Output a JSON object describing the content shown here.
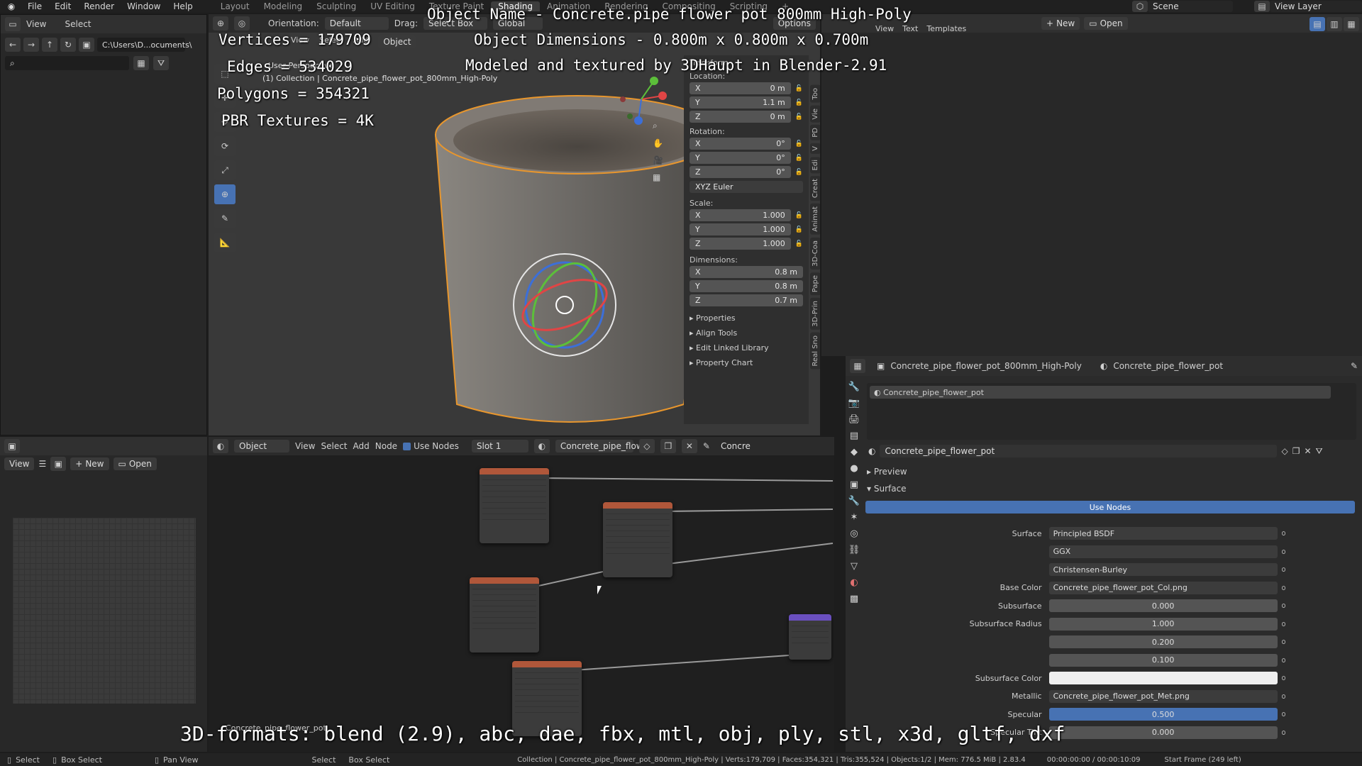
{
  "menu": [
    "File",
    "Edit",
    "Render",
    "Window",
    "Help"
  ],
  "workspaces": [
    "Layout",
    "Modeling",
    "Sculpting",
    "UV Editing",
    "Texture Paint",
    "Shading",
    "Animation",
    "Rendering",
    "Compositing",
    "Scripting"
  ],
  "active_workspace": "Shading",
  "scene": "Scene",
  "view_layer": "View Layer",
  "file_browser": {
    "view": "View",
    "select": "Select",
    "path": "C:\\Users\\D...ocuments\\"
  },
  "viewport": {
    "orientation_label": "Orientation:",
    "orientation_value": "Default",
    "drag_label": "Drag:",
    "drag_value": "Select Box",
    "transform_value": "Global",
    "options": "Options",
    "menu": [
      "View",
      "Select",
      "Add",
      "Object"
    ],
    "view_name": "User Perspective",
    "collection_line": "(1) Collection | Concrete_pipe_flower_pot_800mm_High-Poly"
  },
  "overlay": {
    "vertices": "Vertices = 179709",
    "edges": "Edges = 534029",
    "polygons": "Polygons = 354321",
    "textures": "PBR Textures = 4K",
    "object_name": "Object Name - Concrete.pipe flower pot 800mm High-Poly",
    "object_dims": "Object Dimensions - 0.800m x 0.800m x 0.700m",
    "credit": "Modeled and textured by 3DHaupt in Blender-2.91",
    "formats": "3D-formats: blend (2.9), abc, dae, fbx, mtl, obj, ply, stl, x3d, gltf, dxf"
  },
  "npanel": {
    "transform": "Transform",
    "location_label": "Location:",
    "location": [
      {
        "axis": "X",
        "value": "0 m"
      },
      {
        "axis": "Y",
        "value": "1.1 m"
      },
      {
        "axis": "Z",
        "value": "0 m"
      }
    ],
    "rotation_label": "Rotation:",
    "rotation": [
      {
        "axis": "X",
        "value": "0°"
      },
      {
        "axis": "Y",
        "value": "0°"
      },
      {
        "axis": "Z",
        "value": "0°"
      }
    ],
    "rotation_mode": "XYZ Euler",
    "scale_label": "Scale:",
    "scale": [
      {
        "axis": "X",
        "value": "1.000"
      },
      {
        "axis": "Y",
        "value": "1.000"
      },
      {
        "axis": "Z",
        "value": "1.000"
      }
    ],
    "dimensions_label": "Dimensions:",
    "dimensions": [
      {
        "axis": "X",
        "value": "0.8 m"
      },
      {
        "axis": "Y",
        "value": "0.8 m"
      },
      {
        "axis": "Z",
        "value": "0.7 m"
      }
    ],
    "sections": [
      "Properties",
      "Align Tools",
      "Edit Linked Library",
      "Property Chart"
    ],
    "tabs": [
      "Too",
      "Vie",
      "PD",
      "V",
      "Edi",
      "Creat",
      "Animat",
      "3D-Coa",
      "Pape",
      "3D-Prin",
      "Real Sno"
    ]
  },
  "text_editor": {
    "view": "View",
    "text": "Text",
    "templates": "Templates",
    "new": "New",
    "open": "Open"
  },
  "image_editor": {
    "view": "View",
    "new": "New",
    "open": "Open"
  },
  "node_editor": {
    "mode": "Object",
    "menu": [
      "View",
      "Select",
      "Add",
      "Node"
    ],
    "use_nodes": "Use Nodes",
    "slot": "Slot 1",
    "material": "Concrete_pipe_flow...",
    "material_right": "Concre",
    "frame_label": "Concrete_pipe_flower_pot"
  },
  "properties": {
    "object_name": "Concrete_pipe_flower_pot_800mm_High-Poly",
    "material_name": "Concrete_pipe_flower_pot",
    "slot_item": "Concrete_pipe_flower_pot",
    "material_field": "Concrete_pipe_flower_pot",
    "preview": "Preview",
    "surface_section": "Surface",
    "use_nodes": "Use Nodes",
    "rows": [
      {
        "label": "Surface",
        "value": "Principled BSDF",
        "type": "text"
      },
      {
        "label": "",
        "value": "GGX",
        "type": "text"
      },
      {
        "label": "",
        "value": "Christensen-Burley",
        "type": "text"
      },
      {
        "label": "Base Color",
        "value": "Concrete_pipe_flower_pot_Col.png",
        "type": "text"
      },
      {
        "label": "Subsurface",
        "value": "0.000",
        "type": "num"
      },
      {
        "label": "Subsurface Radius",
        "value": "1.000",
        "type": "num"
      },
      {
        "label": "",
        "value": "0.200",
        "type": "num"
      },
      {
        "label": "",
        "value": "0.100",
        "type": "num"
      },
      {
        "label": "Subsurface Color",
        "value": "",
        "type": "color"
      },
      {
        "label": "Metallic",
        "value": "Concrete_pipe_flower_pot_Met.png",
        "type": "text"
      },
      {
        "label": "Specular",
        "value": "0.500",
        "type": "slider"
      },
      {
        "label": "Specular Tint",
        "value": "0.000",
        "type": "num"
      }
    ]
  },
  "status": {
    "select": "Select",
    "box_select": "Box Select",
    "pan_view": "Pan View",
    "select2": "Select",
    "box_select2": "Box Select",
    "info": "Collection | Concrete_pipe_flower_pot_800mm_High-Poly | Verts:179,709 | Faces:354,321 | Tris:355,524 | Objects:1/2 | Mem: 776.5 MiB | 2.83.4",
    "time": "00:00:00:00 / 00:00:10:09",
    "start_frame": "Start Frame (249 left)"
  }
}
